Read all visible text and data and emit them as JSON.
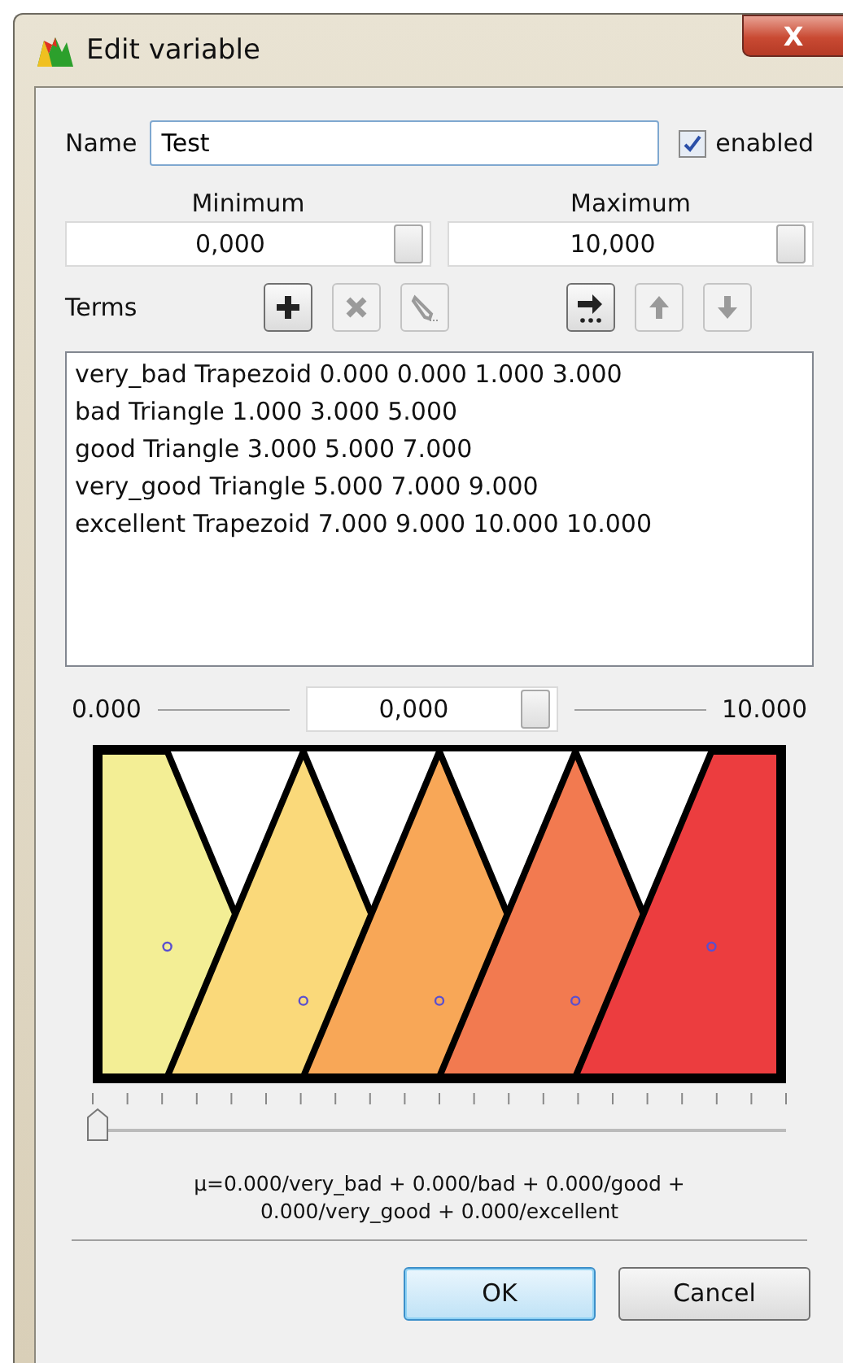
{
  "window": {
    "title": "Edit variable",
    "close": "X"
  },
  "name_field": {
    "label": "Name",
    "value": "Test"
  },
  "enabled": {
    "label": "enabled",
    "checked": true
  },
  "minimum": {
    "label": "Minimum",
    "value": "0,000"
  },
  "maximum": {
    "label": "Maximum",
    "value": "10,000"
  },
  "terms_label": "Terms",
  "tools": [
    {
      "kind": "add",
      "disabled": false
    },
    {
      "kind": "remove",
      "disabled": true
    },
    {
      "kind": "edit",
      "disabled": true
    },
    {
      "kind": "auto",
      "disabled": false
    },
    {
      "kind": "up",
      "disabled": true
    },
    {
      "kind": "down",
      "disabled": true
    }
  ],
  "terms": [
    {
      "name": "very_bad",
      "shape": "Trapezoid",
      "params": [
        "0.000",
        "0.000",
        "1.000",
        "3.000"
      ],
      "color": "#f3ee95"
    },
    {
      "name": "bad",
      "shape": "Triangle",
      "params": [
        "1.000",
        "3.000",
        "5.000"
      ],
      "color": "#fad97a"
    },
    {
      "name": "good",
      "shape": "Triangle",
      "params": [
        "3.000",
        "5.000",
        "7.000"
      ],
      "color": "#f8a757"
    },
    {
      "name": "very_good",
      "shape": "Triangle",
      "params": [
        "5.000",
        "7.000",
        "9.000"
      ],
      "color": "#f27a50"
    },
    {
      "name": "excellent",
      "shape": "Trapezoid",
      "params": [
        "7.000",
        "9.000",
        "10.000",
        "10.000"
      ],
      "color": "#ec3d3f"
    }
  ],
  "range": {
    "min": "0.000",
    "value": "0,000",
    "max": "10.000"
  },
  "slider": {
    "level": 0
  },
  "formula": "μ=0.000/very_bad + 0.000/bad + 0.000/good + 0.000/very_good + 0.000/excellent",
  "buttons": [
    {
      "label": "OK",
      "default": true
    },
    {
      "label": "Cancel",
      "default": false
    }
  ]
}
